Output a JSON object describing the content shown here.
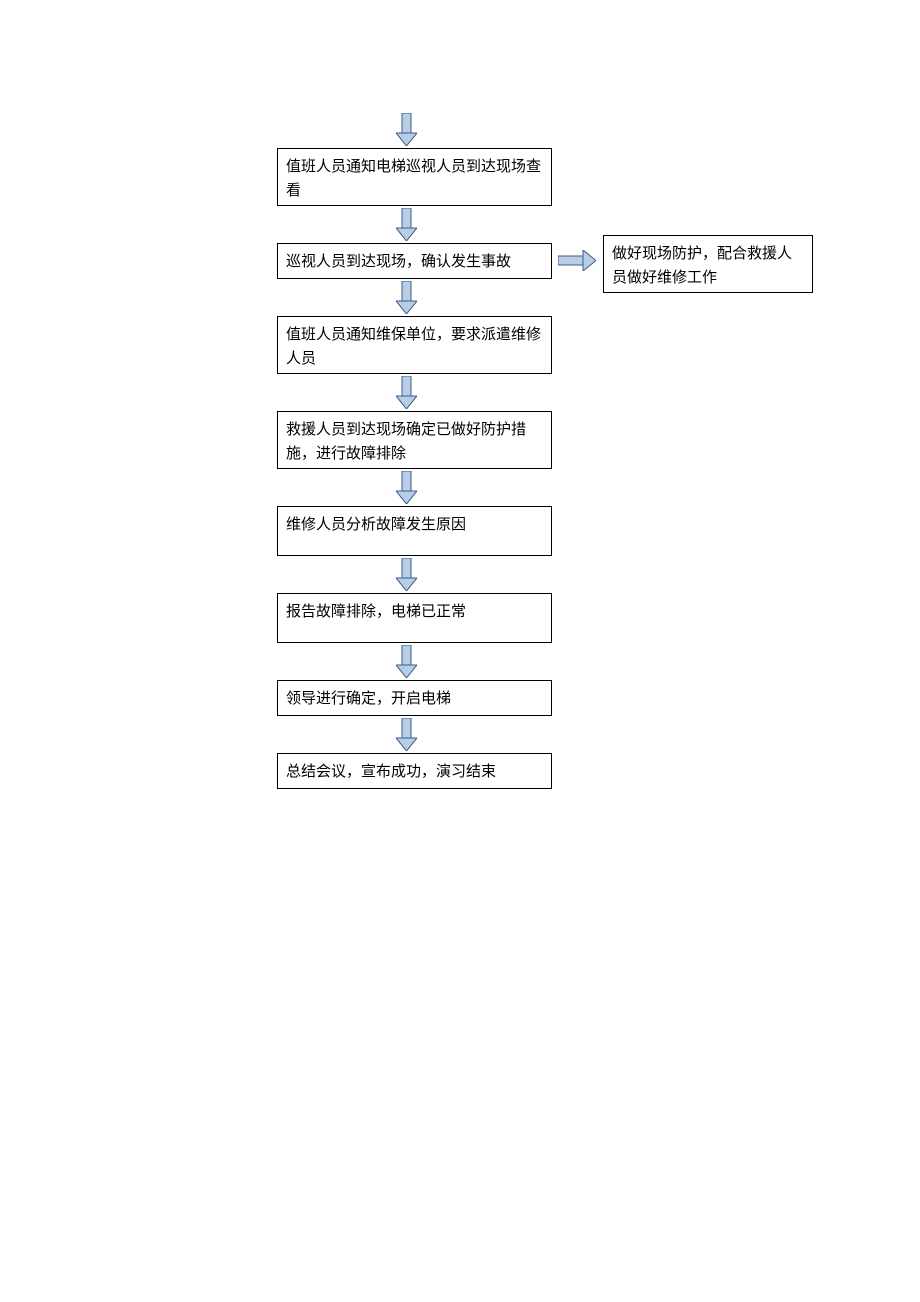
{
  "flowchart": {
    "nodes": [
      {
        "id": "n1",
        "text": "值班人员通知电梯巡视人员到达现场查看"
      },
      {
        "id": "n2",
        "text": "巡视人员到达现场，确认发生事故"
      },
      {
        "id": "n3",
        "text": "值班人员通知维保单位，要求派遣维修人员"
      },
      {
        "id": "n4",
        "text": "救援人员到达现场确定已做好防护措施，进行故障排除"
      },
      {
        "id": "n5",
        "text": "维修人员分析故障发生原因"
      },
      {
        "id": "n6",
        "text": "报告故障排除，电梯已正常"
      },
      {
        "id": "n7",
        "text": "领导进行确定，开启电梯"
      },
      {
        "id": "n8",
        "text": "总结会议，宣布成功，演习结束"
      },
      {
        "id": "side",
        "text": "做好现场防护，配合救援人员做好维修工作"
      }
    ],
    "edges": [
      {
        "from": "start",
        "to": "n1",
        "dir": "down"
      },
      {
        "from": "n1",
        "to": "n2",
        "dir": "down"
      },
      {
        "from": "n2",
        "to": "n3",
        "dir": "down"
      },
      {
        "from": "n2",
        "to": "side",
        "dir": "right"
      },
      {
        "from": "n3",
        "to": "n4",
        "dir": "down"
      },
      {
        "from": "n4",
        "to": "n5",
        "dir": "down"
      },
      {
        "from": "n5",
        "to": "n6",
        "dir": "down"
      },
      {
        "from": "n6",
        "to": "n7",
        "dir": "down"
      },
      {
        "from": "n7",
        "to": "n8",
        "dir": "down"
      }
    ]
  }
}
